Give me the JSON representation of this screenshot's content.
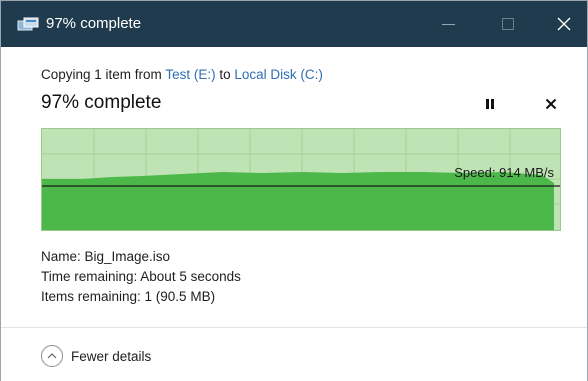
{
  "window": {
    "title": "97% complete",
    "colors": {
      "titlebar": "#1f3b4d",
      "link": "#2f6fb3",
      "graph_bg": "#bfe3b4",
      "graph_fill": "#4cb84a"
    }
  },
  "header": {
    "copy_prefix": "Copying 1 item from ",
    "source": "Test (E:)",
    "to_text": " to ",
    "destination": "Local Disk (C:)",
    "status": "97% complete"
  },
  "graph": {
    "progress_fraction": 0.97,
    "speed_label": "Speed: 914 MB/s",
    "fill_color": "#4cb84a"
  },
  "details": {
    "name": "Name:  Big_Image.iso",
    "time_remaining": "Time remaining:  About 5 seconds",
    "items_remaining": "Items remaining:  1 (90.5 MB)"
  },
  "footer": {
    "toggle_label": "Fewer details"
  },
  "icons": {
    "app": "copy-transfer-icon",
    "pause": "pause-icon",
    "cancel": "close-icon",
    "toggle": "chevron-up-icon"
  }
}
